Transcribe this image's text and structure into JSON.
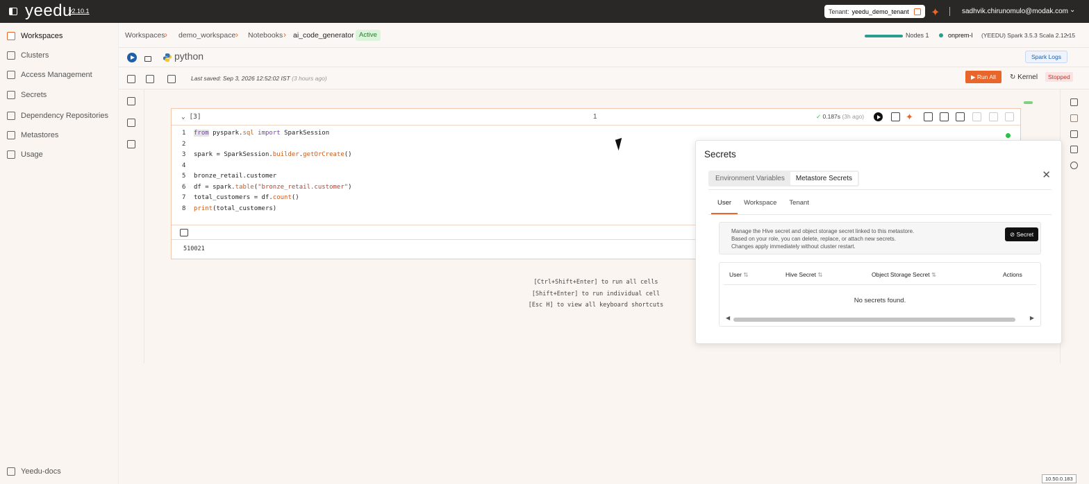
{
  "app": {
    "logo": "yeedu",
    "version": "v2.10.1"
  },
  "header": {
    "tenant_label": "Tenant:",
    "tenant_name": "yeedu_demo_tenant",
    "user_email": "sadhvik.chirunomulo@modak.com"
  },
  "sidebar": {
    "items": [
      {
        "label": "Workspaces",
        "icon": "workspace-icon",
        "active": true
      },
      {
        "label": "Clusters",
        "icon": "cluster-icon"
      },
      {
        "label": "Access Management",
        "icon": "access-icon"
      },
      {
        "label": "Secrets",
        "icon": "key-icon"
      },
      {
        "label": "Dependency Repositories",
        "icon": "repo-icon"
      },
      {
        "label": "Metastores",
        "icon": "database-icon"
      },
      {
        "label": "Usage",
        "icon": "usage-icon"
      }
    ],
    "docs_label": "Yeedu-docs"
  },
  "breadcrumb": {
    "items": [
      "Workspaces",
      "demo_workspace",
      "Notebooks",
      "ai_code_generator"
    ],
    "status": "Active"
  },
  "cluster": {
    "nodes_label": "Nodes 1",
    "name": "onprem-l",
    "version": "(YEEDU) Spark 3.5.3 Scala 2.12.15"
  },
  "toolbar": {
    "language": "python",
    "spark_logs": "Spark Logs",
    "last_saved": "Last saved: Sep 3, 2026 12:52:02 IST",
    "last_saved_ago": "(3 hours ago)",
    "run_all": "Run All",
    "kernel": "Kernel",
    "kernel_status": "Stopped"
  },
  "cell": {
    "exec_count": "[3]",
    "number": "1",
    "time": "0.187s",
    "time_ago": "(3h ago)",
    "output": "510021"
  },
  "hints": [
    "[Ctrl+Shift+Enter] to run all cells",
    "[Shift+Enter] to run individual cell",
    "[Esc H] to view all keyboard shortcuts"
  ],
  "secrets_panel": {
    "title": "Secrets",
    "tabs": [
      "Environment Variables",
      "Metastore Secrets"
    ],
    "sub_tabs": [
      "User",
      "Workspace",
      "Tenant"
    ],
    "info_lines": [
      "Manage the Hive secret and object storage secret linked to this metastore.",
      "Based on your role, you can delete, replace, or attach new secrets.",
      "Changes apply immediately without cluster restart."
    ],
    "add_button": "Secret",
    "columns": [
      "User",
      "Hive Secret",
      "Object Storage Secret",
      "Actions"
    ],
    "empty_text": "No secrets found."
  },
  "footer": {
    "ip": "10.50.0.183"
  },
  "colors": {
    "accent": "#e8662a",
    "topbar": "#2a2826",
    "primary_blue": "#1d5fa8",
    "success": "#2ec04a"
  }
}
